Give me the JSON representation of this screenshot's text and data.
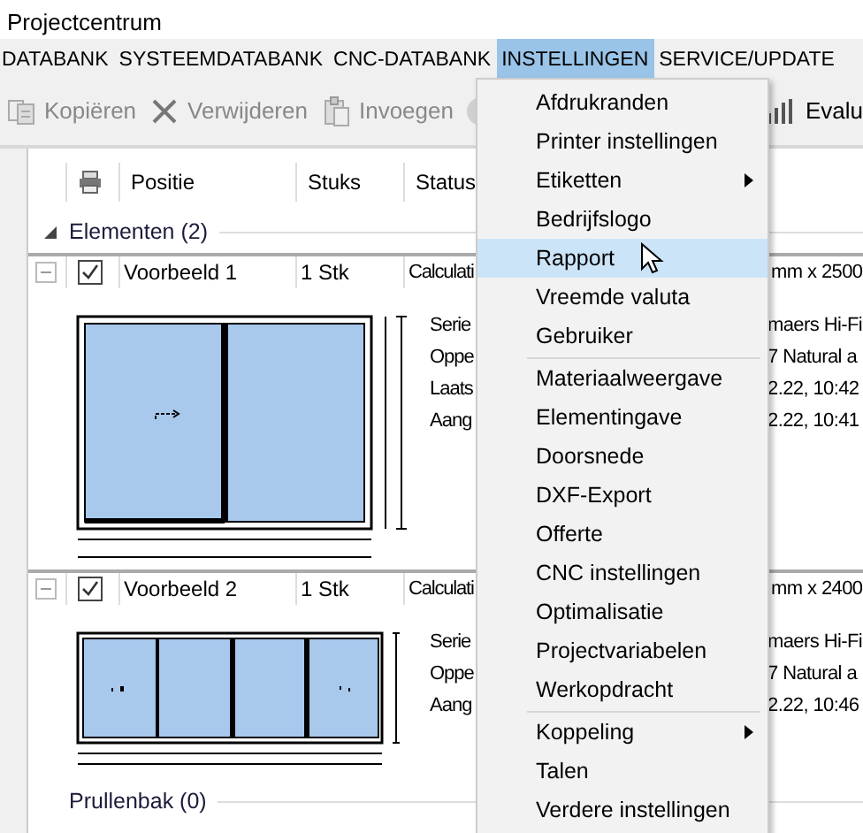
{
  "window": {
    "title": "Projectcentrum"
  },
  "menu_bar": [
    {
      "label": "DATABANK",
      "selected": false
    },
    {
      "label": "SYSTEEMDATABANK",
      "selected": false
    },
    {
      "label": "CNC-DATABANK",
      "selected": false
    },
    {
      "label": "INSTELLINGEN",
      "selected": true
    },
    {
      "label": "SERVICE/UPDATE",
      "selected": false
    }
  ],
  "toolbar": [
    {
      "kind": "copy",
      "label": "Kopiëren",
      "disabled": true
    },
    {
      "kind": "delete",
      "label": "Verwijderen",
      "disabled": true
    },
    {
      "kind": "paste",
      "label": "Invoegen",
      "disabled": true
    },
    {
      "kind": "info",
      "disabled": true
    },
    {
      "kind": "chart",
      "label": "Evalu",
      "disabled": false
    }
  ],
  "table": {
    "columns": [
      "Positie",
      "Stuks",
      "Status"
    ],
    "groups": [
      {
        "title": "Elementen (2)",
        "expanded": true,
        "rows": [
          {
            "position": "Voorbeeld 1",
            "count": "1 Stk",
            "status": "Calculati",
            "size": "mm x 2500",
            "checked": true,
            "kind": "two-pane",
            "details_left": [
              "Serie",
              "Oppe",
              "Laats",
              "Aang"
            ],
            "details_right": [
              "maers Hi-Fi",
              "7 Natural a",
              "2.22, 10:42",
              "2.22, 10:41"
            ]
          },
          {
            "position": "Voorbeeld 2",
            "count": "1 Stk",
            "status": "Calculati",
            "size": "mm x 2400",
            "checked": true,
            "kind": "four-pane",
            "details_left": [
              "Serie",
              "Oppe",
              "Aang"
            ],
            "details_right": [
              "maers Hi-Fi",
              "7 Natural a",
              "2.22, 10:46"
            ]
          }
        ]
      },
      {
        "title": "Prullenbak (0)",
        "expanded": false
      }
    ]
  },
  "dropdown_menu": [
    {
      "kind": "item",
      "label": "Afdrukranden",
      "submenu": false,
      "selected": false
    },
    {
      "kind": "item",
      "label": "Printer instellingen",
      "submenu": false,
      "selected": false
    },
    {
      "kind": "item",
      "label": "Etiketten",
      "submenu": true,
      "selected": false
    },
    {
      "kind": "item",
      "label": "Bedrijfslogo",
      "submenu": false,
      "selected": false
    },
    {
      "kind": "item",
      "label": "Rapport",
      "submenu": false,
      "selected": true
    },
    {
      "kind": "item",
      "label": "Vreemde valuta",
      "submenu": false,
      "selected": false
    },
    {
      "kind": "item",
      "label": "Gebruiker",
      "submenu": false,
      "selected": false
    },
    {
      "kind": "separator"
    },
    {
      "kind": "item",
      "label": "Materiaalweergave",
      "submenu": false,
      "selected": false
    },
    {
      "kind": "item",
      "label": "Elementingave",
      "submenu": false,
      "selected": false
    },
    {
      "kind": "item",
      "label": "Doorsnede",
      "submenu": false,
      "selected": false
    },
    {
      "kind": "item",
      "label": "DXF-Export",
      "submenu": false,
      "selected": false
    },
    {
      "kind": "item",
      "label": "Offerte",
      "submenu": false,
      "selected": false
    },
    {
      "kind": "item",
      "label": "CNC instellingen",
      "submenu": false,
      "selected": false
    },
    {
      "kind": "item",
      "label": "Optimalisatie",
      "submenu": false,
      "selected": false
    },
    {
      "kind": "item",
      "label": "Projectvariabelen",
      "submenu": false,
      "selected": false
    },
    {
      "kind": "item",
      "label": "Werkopdracht",
      "submenu": false,
      "selected": false
    },
    {
      "kind": "separator"
    },
    {
      "kind": "item",
      "label": "Koppeling",
      "submenu": true,
      "selected": false
    },
    {
      "kind": "item",
      "label": "Talen",
      "submenu": false,
      "selected": false
    },
    {
      "kind": "item",
      "label": "Verdere instellingen",
      "submenu": false,
      "selected": false
    }
  ]
}
